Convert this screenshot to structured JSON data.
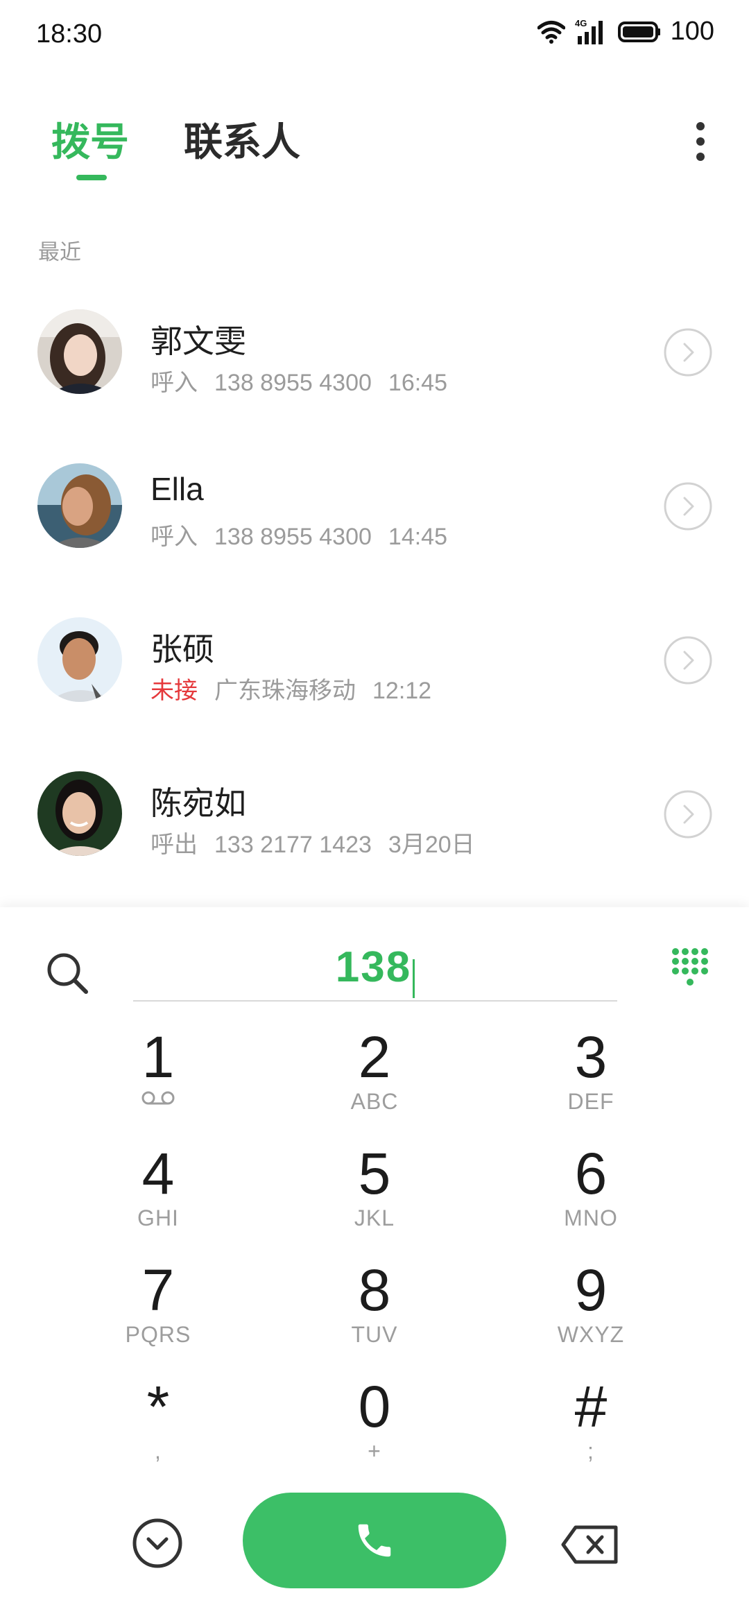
{
  "status_bar": {
    "time": "18:30",
    "network": "4G",
    "battery": "100"
  },
  "tabs": {
    "dial": "拨号",
    "contacts": "联系人"
  },
  "recent": {
    "title": "最近",
    "items": [
      {
        "name": "郭文雯",
        "type": "呼入",
        "detail": "138 8955 4300",
        "time": "16:45",
        "missed": false
      },
      {
        "name": "Ella",
        "type": "呼入",
        "detail": "138 8955 4300",
        "time": "14:45",
        "missed": false
      },
      {
        "name": "张硕",
        "type": "未接",
        "detail": "广东珠海移动",
        "time": "12:12",
        "missed": true
      },
      {
        "name": "陈宛如",
        "type": "呼出",
        "detail": "133 2177 1423",
        "time": "3月20日",
        "missed": false
      }
    ]
  },
  "dialer": {
    "input": "138",
    "keys": [
      {
        "digit": "1",
        "letters": ""
      },
      {
        "digit": "2",
        "letters": "ABC"
      },
      {
        "digit": "3",
        "letters": "DEF"
      },
      {
        "digit": "4",
        "letters": "GHI"
      },
      {
        "digit": "5",
        "letters": "JKL"
      },
      {
        "digit": "6",
        "letters": "MNO"
      },
      {
        "digit": "7",
        "letters": "PQRS"
      },
      {
        "digit": "8",
        "letters": "TUV"
      },
      {
        "digit": "9",
        "letters": "WXYZ"
      },
      {
        "digit": "*",
        "letters": ","
      },
      {
        "digit": "0",
        "letters": "+"
      },
      {
        "digit": "#",
        "letters": ";"
      }
    ],
    "pressed_key": "8"
  },
  "colors": {
    "accent": "#35b85c",
    "call_button": "#3cbf67",
    "missed": "#e5383b"
  },
  "icons": [
    "wifi-icon",
    "signal-icon",
    "battery-icon",
    "more-vert-icon",
    "chevron-right-circle-icon",
    "search-icon",
    "dialpad-icon",
    "voicemail-icon",
    "collapse-icon",
    "phone-icon",
    "backspace-icon"
  ]
}
